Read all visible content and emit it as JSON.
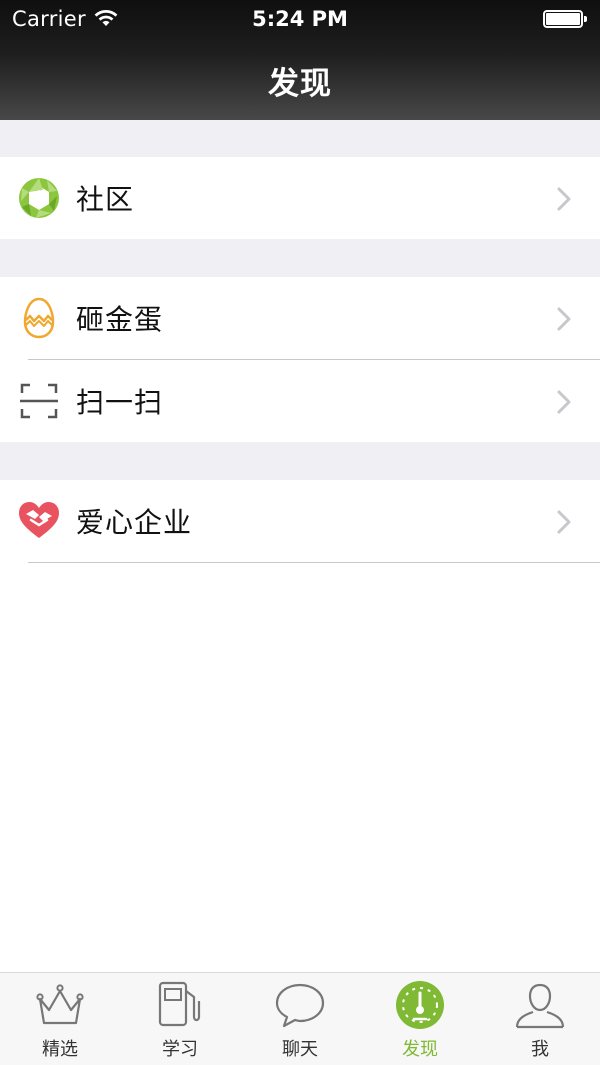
{
  "status_bar": {
    "carrier": "Carrier",
    "time": "5:24 PM"
  },
  "nav": {
    "title": "发现"
  },
  "sections": [
    {
      "items": [
        {
          "label": "社区",
          "icon": "aperture-icon"
        }
      ]
    },
    {
      "items": [
        {
          "label": "砸金蛋",
          "icon": "golden-egg-icon"
        },
        {
          "label": "扫一扫",
          "icon": "scan-icon"
        }
      ]
    },
    {
      "items": [
        {
          "label": "爱心企业",
          "icon": "heart-hands-icon"
        }
      ]
    }
  ],
  "tabbar": {
    "items": [
      {
        "label": "精选",
        "icon": "crown-icon"
      },
      {
        "label": "学习",
        "icon": "fuel-pump-icon"
      },
      {
        "label": "聊天",
        "icon": "chat-bubble-icon"
      },
      {
        "label": "发现",
        "icon": "compass-icon"
      },
      {
        "label": "我",
        "icon": "person-icon"
      }
    ],
    "active": "发现"
  },
  "colors": {
    "accent": "#80b933",
    "nav_bg": "#1e1e1e",
    "group_gap": "#efeff4",
    "heart": "#e95360",
    "egg": "#f0a830"
  }
}
